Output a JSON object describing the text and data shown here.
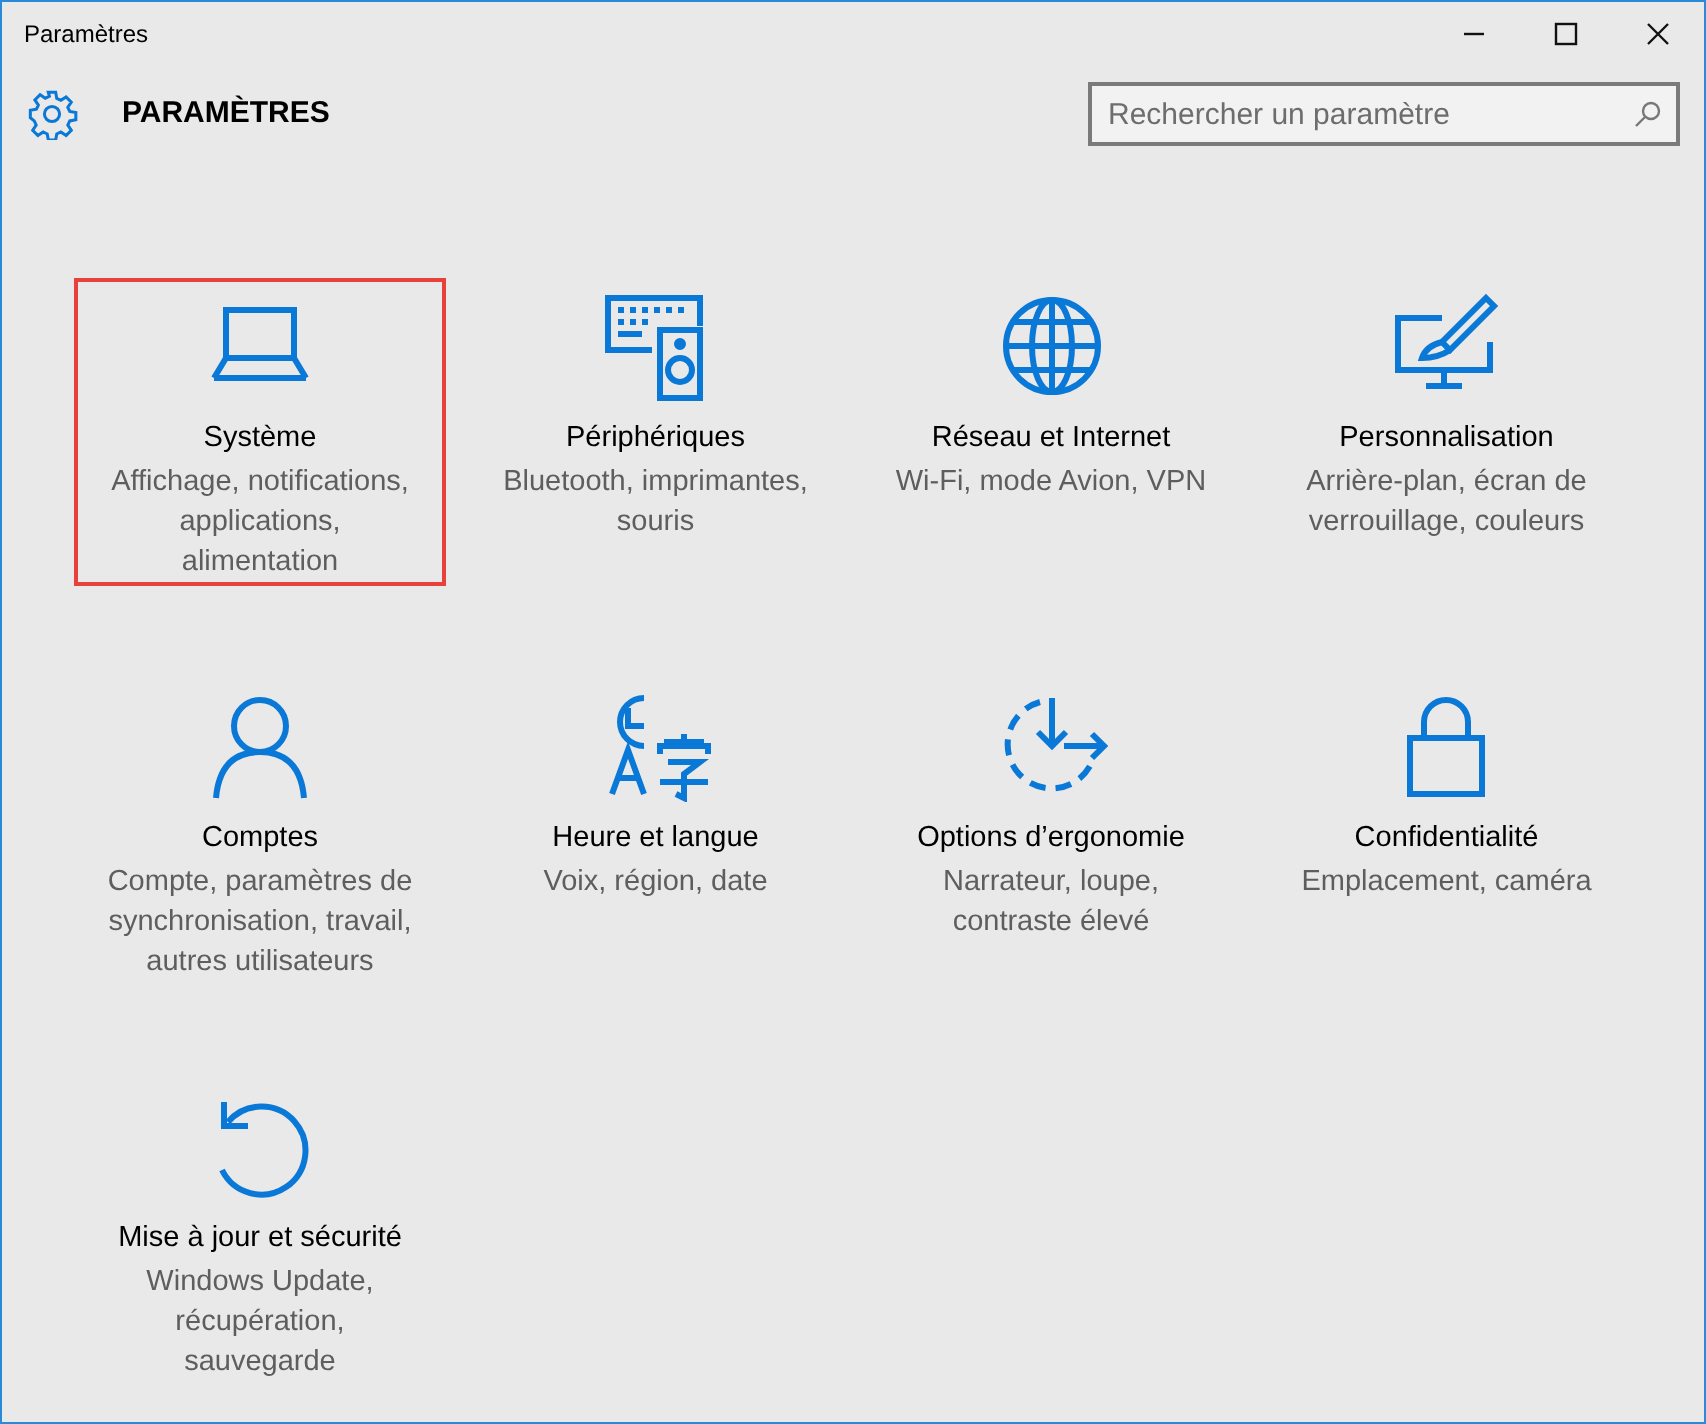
{
  "window": {
    "title": "Paramètres",
    "controls": [
      {
        "kind": "minimize"
      },
      {
        "kind": "maximize"
      },
      {
        "kind": "close"
      }
    ]
  },
  "header": {
    "title": "PARAMÈTRES",
    "search": {
      "placeholder": "Rechercher un paramètre"
    }
  },
  "tiles": [
    {
      "kind": "laptop",
      "title": "Système",
      "description": [
        "Affichage, notifications,",
        "applications,",
        "alimentation"
      ],
      "selected": true
    },
    {
      "kind": "devices",
      "title": "Périphériques",
      "description": [
        "Bluetooth, imprimantes,",
        "souris"
      ],
      "selected": false
    },
    {
      "kind": "globe",
      "title": "Réseau et Internet",
      "description": [
        "Wi-Fi, mode Avion, VPN"
      ],
      "selected": false
    },
    {
      "kind": "brush",
      "title": "Personnalisation",
      "description": [
        "Arrière-plan, écran de",
        "verrouillage, couleurs"
      ],
      "selected": false
    },
    {
      "kind": "person",
      "title": "Comptes",
      "description": [
        "Compte, paramètres de",
        "synchronisation, travail,",
        "autres utilisateurs"
      ],
      "selected": false
    },
    {
      "kind": "language",
      "title": "Heure et langue",
      "description": [
        "Voix, région, date"
      ],
      "selected": false
    },
    {
      "kind": "ease",
      "title": "Options d’ergonomie",
      "description": [
        "Narrateur, loupe,",
        "contraste élevé"
      ],
      "selected": false
    },
    {
      "kind": "lock",
      "title": "Confidentialité",
      "description": [
        "Emplacement, caméra"
      ],
      "selected": false
    },
    {
      "kind": "update",
      "title": "Mise à jour et sécurité",
      "description": [
        "Windows Update,",
        "récupération,",
        "sauvegarde"
      ],
      "selected": false
    }
  ]
}
